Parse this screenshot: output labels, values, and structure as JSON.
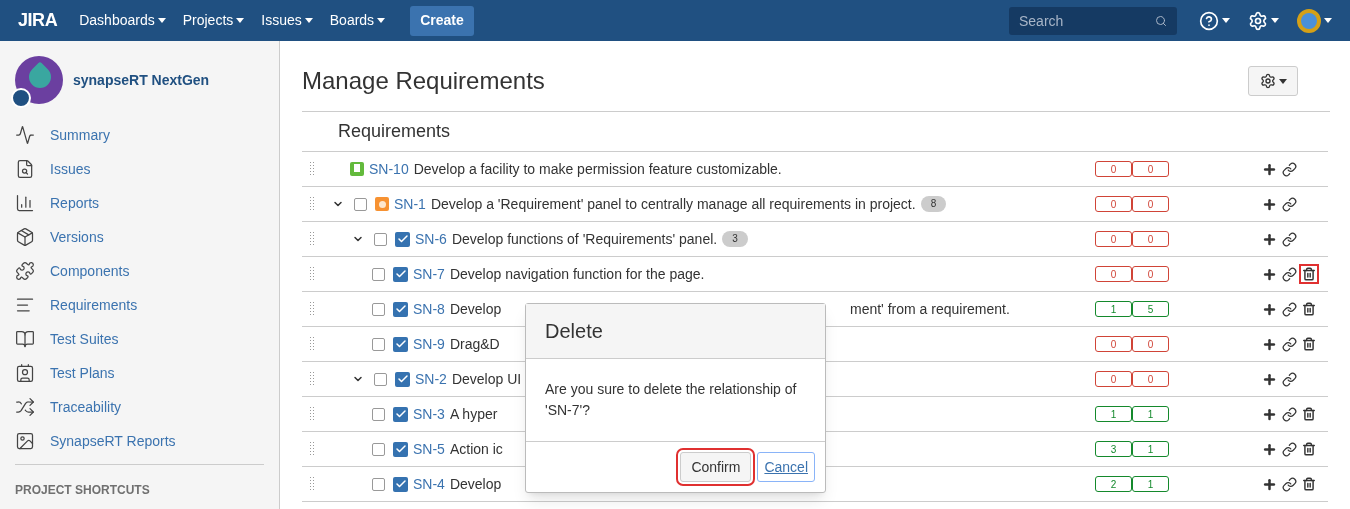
{
  "header": {
    "logo": "JIRA",
    "menus": [
      {
        "label": "Dashboards"
      },
      {
        "label": "Projects"
      },
      {
        "label": "Issues"
      },
      {
        "label": "Boards"
      }
    ],
    "create": "Create",
    "search": {
      "placeholder": "Search"
    }
  },
  "sidebar": {
    "project": "synapseRT NextGen",
    "items": [
      {
        "label": "Summary"
      },
      {
        "label": "Issues"
      },
      {
        "label": "Reports"
      },
      {
        "label": "Versions"
      },
      {
        "label": "Components"
      },
      {
        "label": "Requirements"
      },
      {
        "label": "Test Suites"
      },
      {
        "label": "Test Plans"
      },
      {
        "label": "Traceability"
      },
      {
        "label": "SynapseRT Reports"
      }
    ],
    "section": "PROJECT SHORTCUTS"
  },
  "page": {
    "title": "Manage Requirements",
    "table_title": "Requirements",
    "rows": [
      {
        "key": "SN-10",
        "summary": "Develop a facility to make permission feature customizable.",
        "kind": "story",
        "checkbox": false,
        "expanded": null,
        "counts": [
          "0",
          "0"
        ],
        "color": "#d04437",
        "delete": false
      },
      {
        "key": "SN-1",
        "summary": "Develop a 'Requirement' panel to centrally manage all requirements in project.",
        "badge": "8",
        "kind": "epic",
        "checkbox": true,
        "checked": false,
        "expanded": true,
        "counts": [
          "0",
          "0"
        ],
        "color": "#d04437",
        "delete": false,
        "children": [
          {
            "key": "SN-6",
            "summary": "Develop functions of 'Requirements' panel.",
            "badge": "3",
            "kind": "requirement",
            "checkbox": true,
            "checked": false,
            "expanded": true,
            "counts": [
              "0",
              "0"
            ],
            "color": "#d04437",
            "delete": false,
            "children": [
              {
                "key": "SN-7",
                "summary": "Develop navigation function for the page.",
                "kind": "requirement",
                "checkbox": true,
                "checked": false,
                "counts": [
                  "0",
                  "0"
                ],
                "color": "#d04437",
                "delete": true,
                "highlighted": true
              },
              {
                "key": "SN-8",
                "summary": "Develop",
                "summary_tail": "ment' from a requirement.",
                "kind": "requirement",
                "checkbox": true,
                "checked": false,
                "counts": [
                  "1",
                  "5"
                ],
                "color": "#14892c",
                "delete": true,
                "highlighted": false
              },
              {
                "key": "SN-9",
                "summary": "Drag&D",
                "kind": "requirement",
                "checkbox": true,
                "checked": false,
                "counts": [
                  "0",
                  "0"
                ],
                "color": "#d04437",
                "delete": true,
                "highlighted": false
              }
            ]
          },
          {
            "key": "SN-2",
            "summary": "Develop UI",
            "kind": "requirement",
            "checkbox": true,
            "checked": false,
            "expanded": true,
            "counts": [
              "0",
              "0"
            ],
            "color": "#d04437",
            "delete": false,
            "children": [
              {
                "key": "SN-3",
                "summary": "A hyper",
                "kind": "requirement",
                "checkbox": true,
                "checked": false,
                "counts": [
                  "1",
                  "1"
                ],
                "color": "#14892c",
                "delete": true,
                "highlighted": false
              },
              {
                "key": "SN-5",
                "summary": "Action ic",
                "kind": "requirement",
                "checkbox": true,
                "checked": false,
                "counts": [
                  "3",
                  "1"
                ],
                "color": "#14892c",
                "delete": true,
                "highlighted": false
              },
              {
                "key": "SN-4",
                "summary": "Develop",
                "kind": "requirement",
                "checkbox": true,
                "checked": false,
                "counts": [
                  "2",
                  "1"
                ],
                "color": "#14892c",
                "delete": true,
                "highlighted": false
              }
            ]
          }
        ]
      }
    ]
  },
  "dialog": {
    "title": "Delete",
    "message": "Are you sure to delete the relationship of 'SN-7'?",
    "confirm": {
      "label": "Confirm",
      "highlighted": true
    },
    "cancel": {
      "label": "Cancel",
      "focused": true
    }
  }
}
